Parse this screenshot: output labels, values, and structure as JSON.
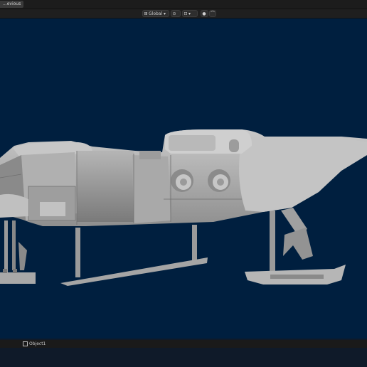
{
  "topbar": {
    "tab_label": "...evious"
  },
  "header": {
    "orientation_label": "Global",
    "orientation_icon": "transform-orientation-icon",
    "pivot_icon": "pivot-point-icon",
    "snap_icon": "snap-icon",
    "proportional_icon": "proportional-editing-icon"
  },
  "viewport": {
    "background_color": "#001f3f",
    "object_name": "helicopter-model"
  },
  "status": {
    "object_label": "Object1"
  }
}
